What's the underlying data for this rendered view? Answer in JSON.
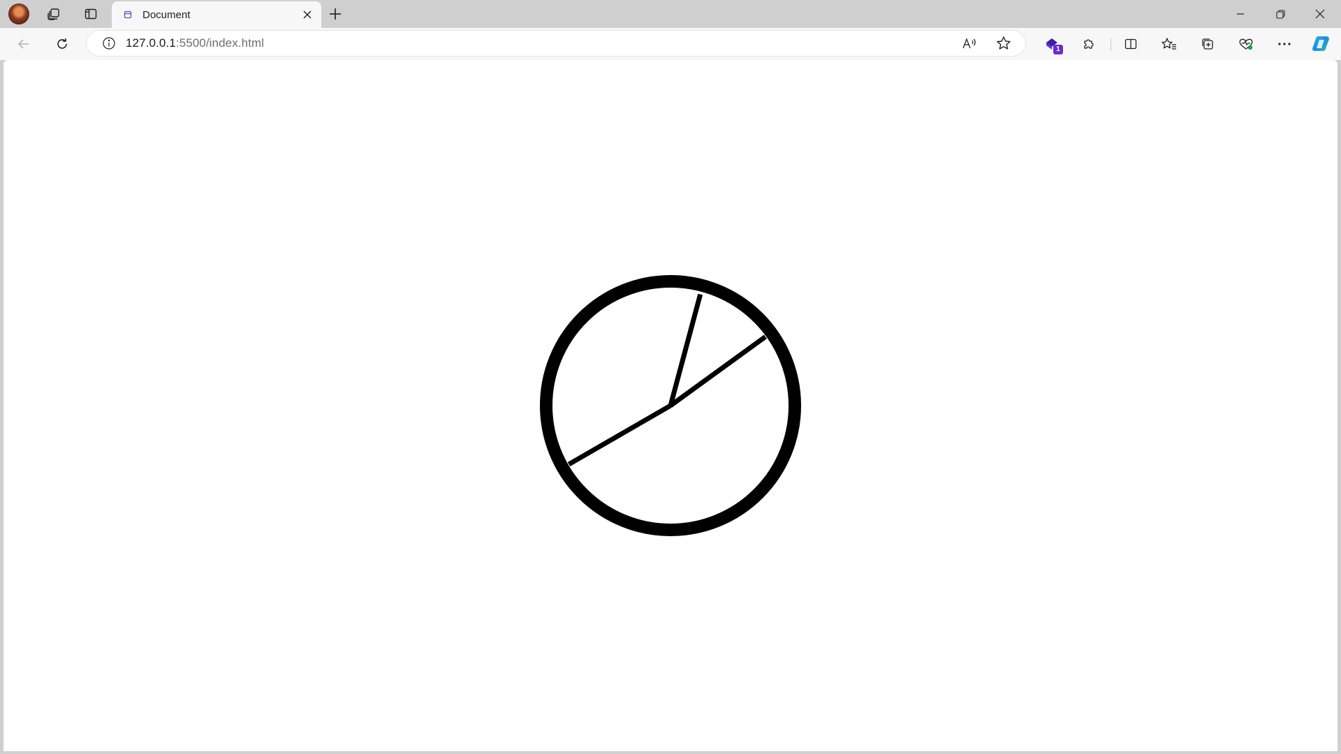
{
  "browser": {
    "tab": {
      "title": "Document",
      "close_icon": "close-icon"
    },
    "address": {
      "url_host": "127.0.0.1",
      "url_rest": ":5500/index.html"
    },
    "extensions": {
      "badge_count": "1"
    },
    "colors": {
      "tabstrip_bg": "#cfcfcf",
      "toolbar_bg": "#f7f7f7",
      "extension_accent": "#6a2bd1",
      "copilot_accent": "#1b8ae6"
    },
    "icons": [
      "profile-avatar",
      "workspaces-icon",
      "vertical-tabs-icon",
      "document-favicon",
      "close-icon",
      "new-tab-icon",
      "minimize-icon",
      "restore-icon",
      "close-window-icon",
      "back-icon",
      "refresh-icon",
      "info-icon",
      "read-aloud-icon",
      "favorite-star-icon",
      "extension-icon",
      "extensions-puzzle-icon",
      "split-screen-icon",
      "favorites-icon",
      "collections-icon",
      "browser-essentials-icon",
      "more-icon",
      "copilot-icon"
    ]
  },
  "page": {
    "clock": {
      "hands": [
        {
          "name": "hour-hand",
          "angle_deg": 54
        },
        {
          "name": "minute-hand",
          "angle_deg": 15
        },
        {
          "name": "second-hand",
          "angle_deg": 240
        }
      ]
    }
  }
}
